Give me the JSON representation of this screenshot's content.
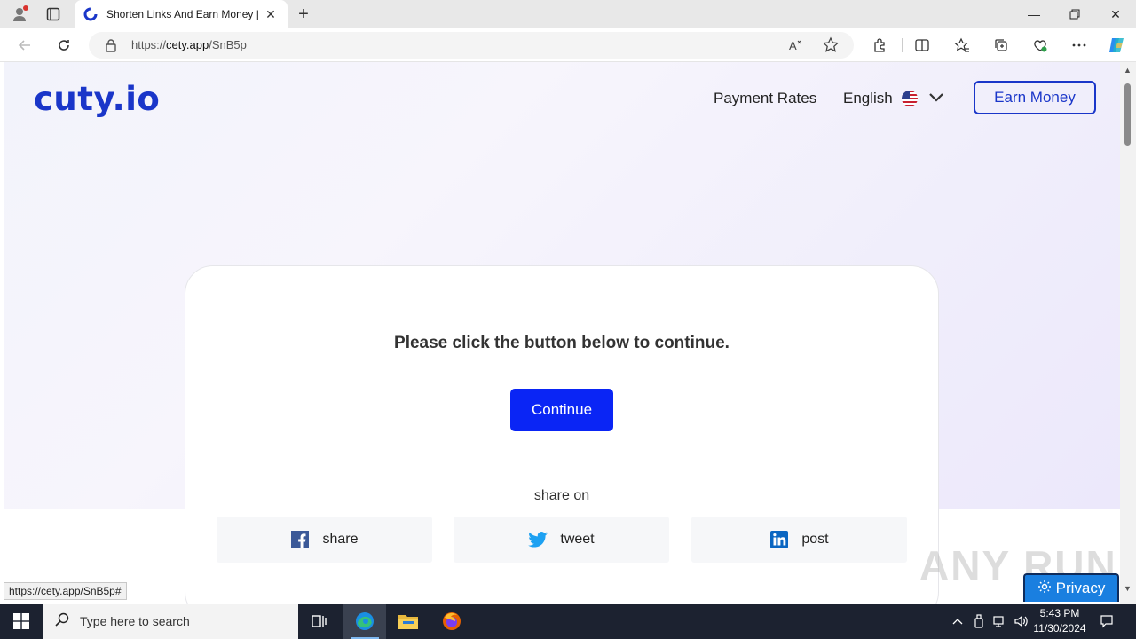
{
  "browser": {
    "tab_title": "Shorten Links And Earn Money | ",
    "url_prefix": "https://",
    "url_host": "cety.app",
    "url_path": "/SnB5p",
    "status_url": "https://cety.app/SnB5p#"
  },
  "page": {
    "logo": "cuty.io",
    "nav": {
      "payment_rates": "Payment Rates",
      "language": "English",
      "earn_money": "Earn Money"
    },
    "card": {
      "message": "Please click the button below to continue.",
      "continue_label": "Continue",
      "share_on": "share on",
      "share_buttons": [
        {
          "label": "share",
          "icon": "facebook-icon"
        },
        {
          "label": "tweet",
          "icon": "twitter-icon"
        },
        {
          "label": "post",
          "icon": "linkedin-icon"
        }
      ]
    },
    "privacy_label": "Privacy",
    "watermark": "ANY RUN"
  },
  "taskbar": {
    "search_placeholder": "Type here to search",
    "time": "5:43 PM",
    "date": "11/30/2024"
  },
  "colors": {
    "brand": "#1a36c9",
    "continue": "#0a25f5",
    "privacy": "#1a7fe0"
  }
}
